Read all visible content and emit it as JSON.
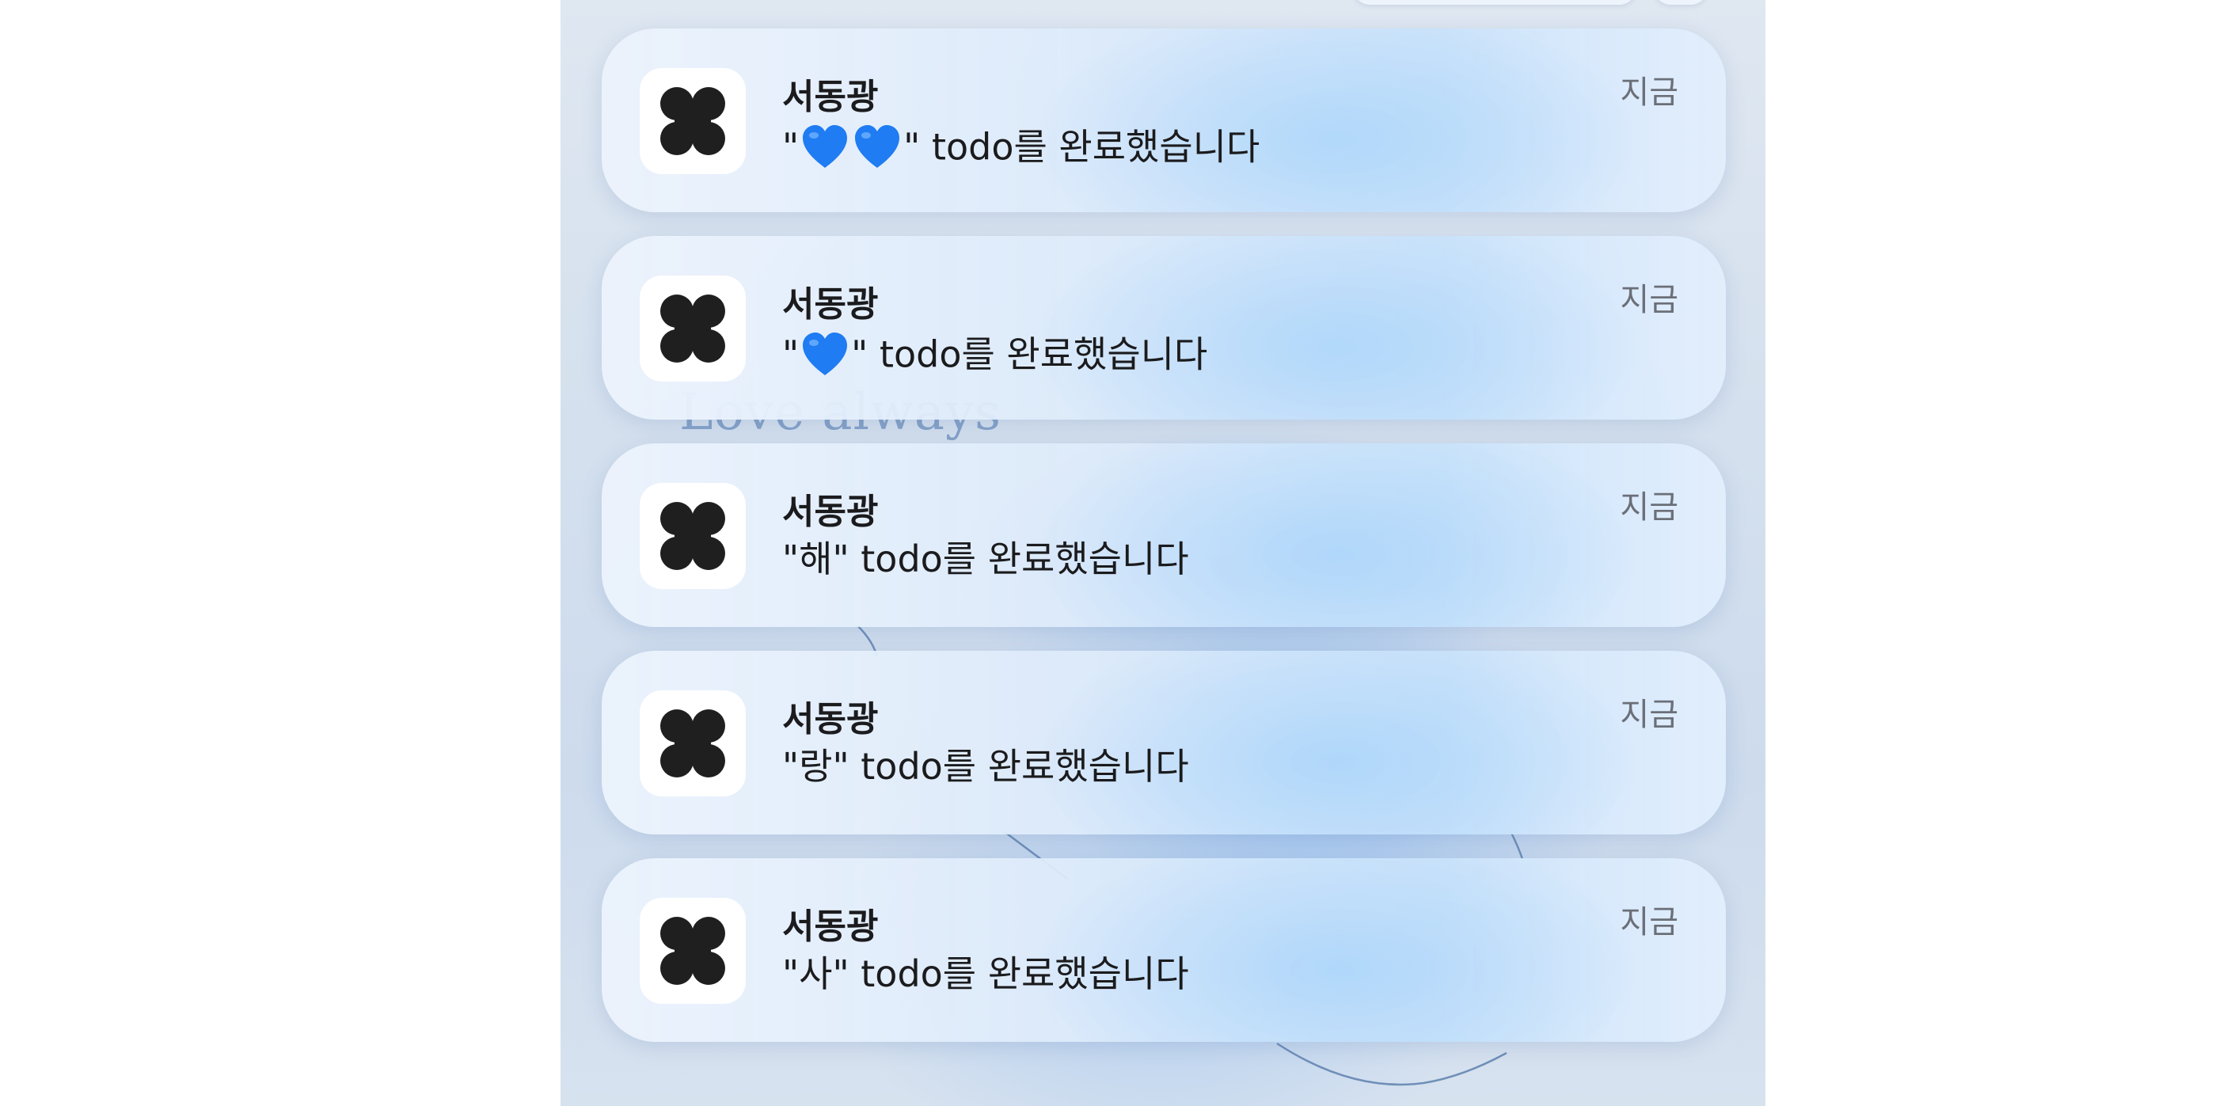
{
  "wallpaper": {
    "text": "Love always"
  },
  "notifications": [
    {
      "sender": "서동광",
      "time": "지금",
      "message_before": "\"",
      "message_after": "\" todo를 완료했습니다",
      "emoji_count": 2,
      "emoji": "blue-heart"
    },
    {
      "sender": "서동광",
      "time": "지금",
      "message_before": "\"",
      "message_after": "\" todo를 완료했습니다",
      "emoji_count": 1,
      "emoji": "blue-heart"
    },
    {
      "sender": "서동광",
      "time": "지금",
      "message": "\"해\" todo를 완료했습니다"
    },
    {
      "sender": "서동광",
      "time": "지금",
      "message": "\"랑\" todo를 완료했습니다"
    },
    {
      "sender": "서동광",
      "time": "지금",
      "message": "\"사\" todo를 완료했습니다"
    }
  ],
  "colors": {
    "heart": "#1f7cf2",
    "icon_glyph": "#1f1f1f",
    "time_text": "#6b6f78"
  }
}
